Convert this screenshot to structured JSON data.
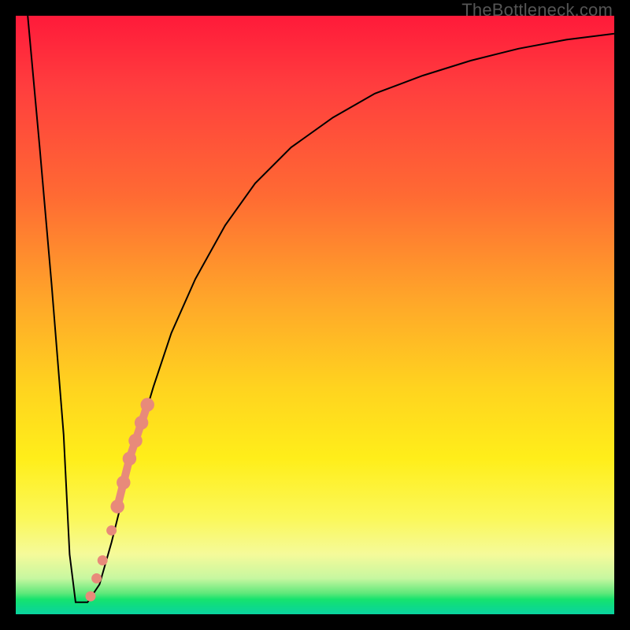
{
  "watermark": "TheBottleneck.com",
  "chart_data": {
    "type": "line",
    "title": "",
    "xlabel": "",
    "ylabel": "",
    "xlim": [
      0,
      100
    ],
    "ylim": [
      0,
      100
    ],
    "background_gradient": {
      "top": "#ff1a3a",
      "mid_upper": "#ffa829",
      "mid": "#ffee1a",
      "mid_lower": "#f5fa9a",
      "bottom": "#0ad3a0"
    },
    "series": [
      {
        "name": "bottleneck-curve",
        "color": "#000000",
        "x": [
          2,
          4,
          6,
          8,
          9,
          10,
          11,
          12,
          14,
          16,
          18,
          20,
          23,
          26,
          30,
          35,
          40,
          46,
          53,
          60,
          68,
          76,
          84,
          92,
          100
        ],
        "y": [
          100,
          78,
          55,
          30,
          10,
          2,
          2,
          2,
          5,
          12,
          20,
          28,
          38,
          47,
          56,
          65,
          72,
          78,
          83,
          87,
          90,
          92.5,
          94.5,
          96,
          97
        ]
      }
    ],
    "markers": {
      "name": "highlight-dots",
      "color": "#e88a7a",
      "points": [
        {
          "x": 12.5,
          "y": 3
        },
        {
          "x": 13.5,
          "y": 6
        },
        {
          "x": 14.5,
          "y": 9
        },
        {
          "x": 16.0,
          "y": 14
        },
        {
          "x": 17.0,
          "y": 18
        },
        {
          "x": 18.0,
          "y": 22
        },
        {
          "x": 19.0,
          "y": 26
        },
        {
          "x": 20.0,
          "y": 29
        },
        {
          "x": 21.0,
          "y": 32
        },
        {
          "x": 22.0,
          "y": 35
        }
      ]
    }
  }
}
